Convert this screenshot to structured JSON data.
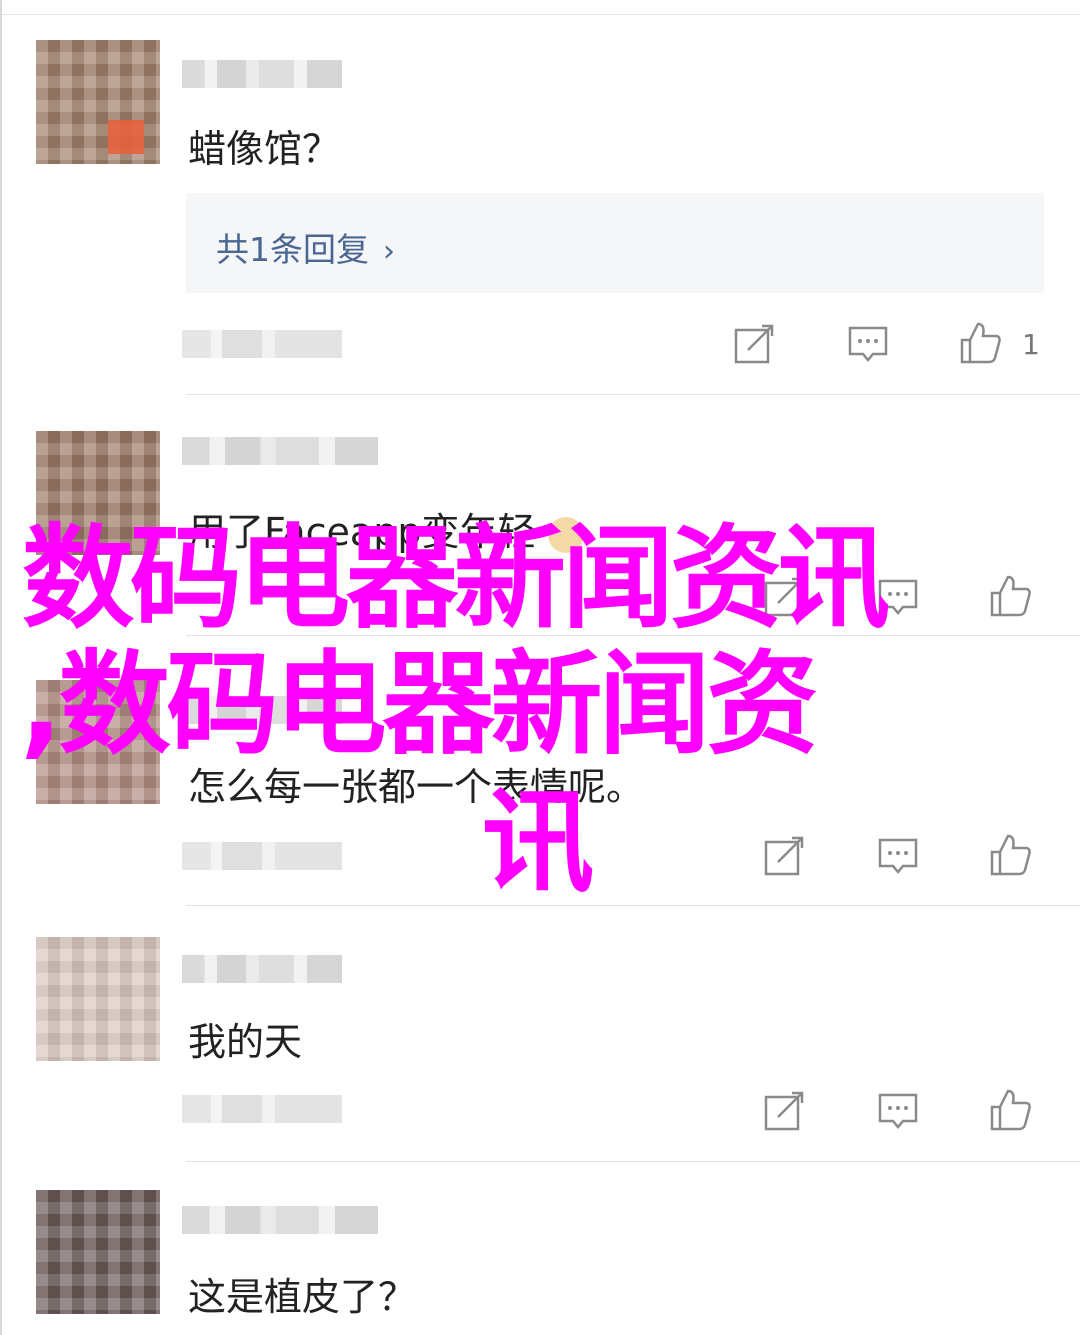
{
  "overlay": {
    "line1": "数码电器新闻资讯",
    "line2": ",数码电器新闻资",
    "line3": "讯",
    "color": "#ff00ff"
  },
  "comments": [
    {
      "text": "蜡像馆？",
      "reply_summary": "共1条回复",
      "reply_chevron": "›",
      "like_count": "1"
    },
    {
      "text": "用了Faceapp变年轻"
    },
    {
      "text": "怎么每一张都一个表情呢。"
    },
    {
      "text": "我的天"
    },
    {
      "text": "这是植皮了？"
    }
  ],
  "icons": {
    "edit": "share-edit-icon",
    "comment": "comment-bubble-icon",
    "like": "thumbs-up-icon"
  },
  "colors": {
    "reply_link": "#4b6690",
    "text": "#222222",
    "icon": "#8a8a8a"
  }
}
